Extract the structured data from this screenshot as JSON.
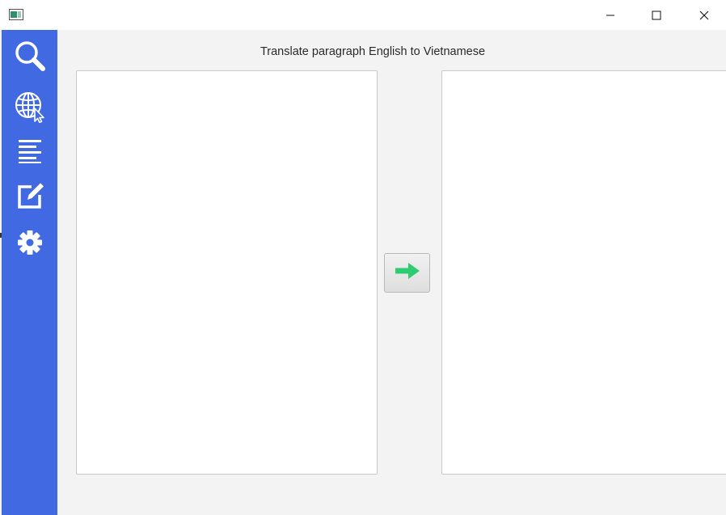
{
  "window": {
    "title": "",
    "controls": {
      "minimize": "minimize-icon",
      "maximize": "maximize-icon",
      "close": "close-icon"
    }
  },
  "sidebar": {
    "color": "#4169e1",
    "items": [
      {
        "name": "search",
        "icon": "search-icon"
      },
      {
        "name": "web",
        "icon": "globe-cursor-icon"
      },
      {
        "name": "paragraph",
        "icon": "align-left-icon"
      },
      {
        "name": "edit",
        "icon": "edit-icon"
      },
      {
        "name": "settings",
        "icon": "gear-icon"
      }
    ]
  },
  "main": {
    "heading": "Translate paragraph English to Vietnamese",
    "source_text": "",
    "target_text": "",
    "translate_button": {
      "icon": "arrow-right-icon",
      "icon_color": "#2ecc71"
    }
  }
}
